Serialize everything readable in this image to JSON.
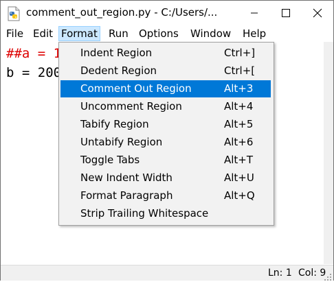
{
  "window": {
    "title": "comment_out_region.py - C:/Users/...",
    "app_icon": "python-file-icon",
    "controls": {
      "minimize": "minimize-icon",
      "maximize": "maximize-icon",
      "close": "close-icon"
    }
  },
  "menubar": {
    "items": [
      "File",
      "Edit",
      "Format",
      "Run",
      "Options",
      "Window",
      "Help"
    ],
    "active": "Format"
  },
  "editor": {
    "lines": [
      "##a = 1",
      "b = 200"
    ]
  },
  "format_menu": {
    "items": [
      {
        "label": "Indent Region",
        "accel": "Ctrl+]"
      },
      {
        "label": "Dedent Region",
        "accel": "Ctrl+["
      },
      {
        "label": "Comment Out Region",
        "accel": "Alt+3"
      },
      {
        "label": "Uncomment Region",
        "accel": "Alt+4"
      },
      {
        "label": "Tabify Region",
        "accel": "Alt+5"
      },
      {
        "label": "Untabify Region",
        "accel": "Alt+6"
      },
      {
        "label": "Toggle Tabs",
        "accel": "Alt+T"
      },
      {
        "label": "New Indent Width",
        "accel": "Alt+U"
      },
      {
        "label": "Format Paragraph",
        "accel": "Alt+Q"
      },
      {
        "label": "Strip Trailing Whitespace",
        "accel": ""
      }
    ],
    "selected": "Comment Out Region"
  },
  "status": {
    "line": "Ln: 1",
    "col": "Col: 9"
  },
  "colors": {
    "comment": "#dd0000",
    "selection": "#0078d7",
    "menu_active": "#cce8ff"
  }
}
